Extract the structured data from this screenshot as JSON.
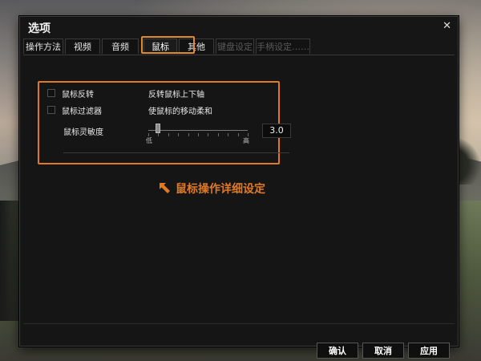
{
  "dialog": {
    "title": "选项"
  },
  "tabs": [
    {
      "label": "操作方法",
      "state": "normal"
    },
    {
      "label": "视频",
      "state": "normal"
    },
    {
      "label": "音频",
      "state": "normal"
    },
    {
      "label": "鼠标",
      "state": "active"
    },
    {
      "label": "其他",
      "state": "normal"
    },
    {
      "label": "键盘设定",
      "state": "disabled"
    },
    {
      "label": "手柄设定……",
      "state": "disabled"
    }
  ],
  "mouse": {
    "invert": {
      "label": "鼠标反转",
      "description": "反转鼠标上下轴",
      "checked": false
    },
    "filter": {
      "label": "鼠标过滤器",
      "description": "使鼠标的移动柔和",
      "checked": false
    },
    "sensitivity": {
      "label": "鼠标灵敏度",
      "value": "3.0",
      "low_label": "低",
      "high_label": "高",
      "level_fraction": 0.1
    }
  },
  "annotation": {
    "text": "鼠标操作详细设定",
    "color": "#e07a22"
  },
  "buttons": {
    "confirm": "确认",
    "cancel": "取消",
    "apply": "应用"
  },
  "icons": {
    "close": "close-icon",
    "annotation_arrow": "arrow-up-left-icon"
  }
}
